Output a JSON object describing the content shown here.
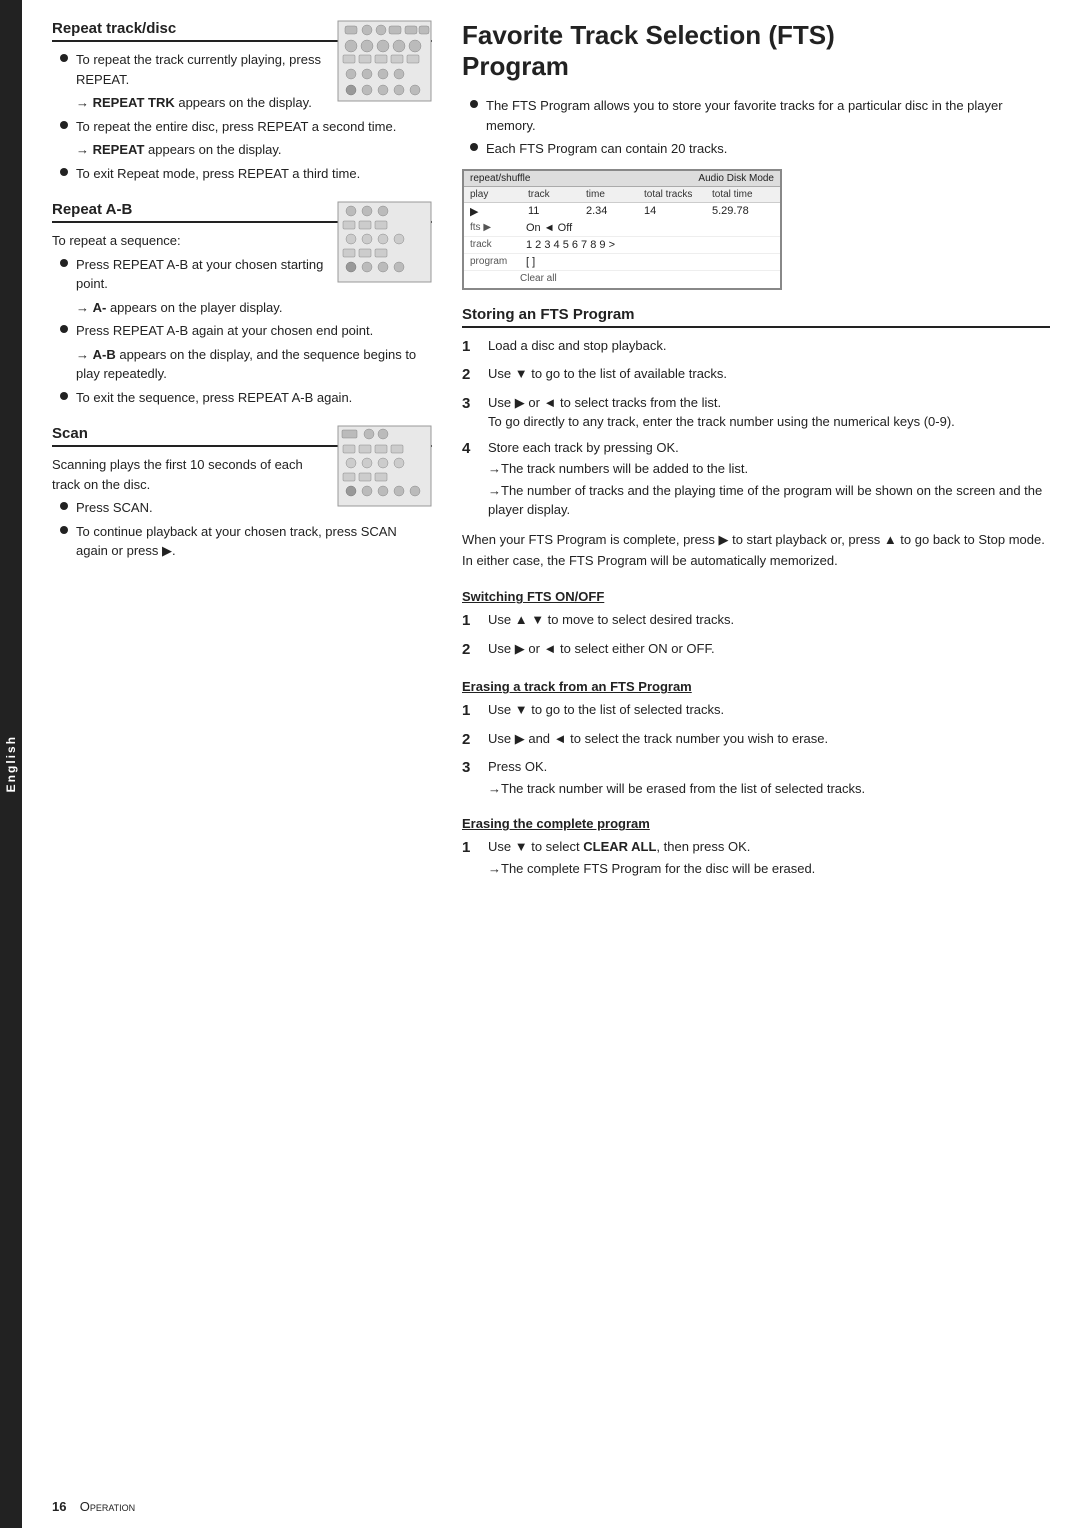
{
  "sidebar": {
    "label": "English"
  },
  "left": {
    "repeat_track_disc": {
      "title": "Repeat track/disc",
      "bullets": [
        "To repeat the track currently playing, press REPEAT.",
        "To repeat the entire disc, press REPEAT a second time.",
        "To exit Repeat mode, press REPEAT a third time."
      ],
      "arrows": [
        "→ REPEAT TRK appears on the display.",
        "→ REPEAT appears on the display."
      ]
    },
    "repeat_ab": {
      "title": "Repeat A-B",
      "intro": "To repeat a sequence:",
      "bullets": [
        "Press REPEAT A-B at your chosen starting point.",
        "Press REPEAT A-B again at your chosen end point.",
        "To exit the sequence, press REPEAT A-B again."
      ],
      "arrows": [
        "→ A- appears on the player display.",
        "→ A-B appears on the display, and the sequence begins to play repeatedly."
      ]
    },
    "scan": {
      "title": "Scan",
      "intro": "Scanning plays the first 10 seconds of each track on the disc.",
      "bullets": [
        "Press SCAN.",
        "To continue playback at your chosen track, press SCAN again or press ▶."
      ]
    }
  },
  "right": {
    "main_title_line1": "Favorite Track Selection (FTS)",
    "main_title_line2": "Program",
    "intro_bullets": [
      "The FTS Program allows you to store your favorite tracks for a particular disc in the player memory.",
      "Each FTS Program can contain 20 tracks."
    ],
    "fts_screen": {
      "header_left": "repeat/shuffle",
      "header_right": "Audio Disk Mode",
      "col_headers": [
        "play",
        "track",
        "time",
        "total tracks",
        "total time"
      ],
      "data_row": [
        "▶",
        "11",
        "2.34",
        "14",
        "5.29.78"
      ],
      "fts_label": "fts",
      "fts_value": "On ◄ Off",
      "track_label": "track",
      "track_value": "1  2  3  4  5  6  7  8  9  >",
      "program_label": "program",
      "program_value": "[ ]",
      "clear_all": "Clear all"
    },
    "storing_title": "Storing an FTS Program",
    "storing_steps": [
      {
        "num": "1",
        "text": "Load a disc and stop playback."
      },
      {
        "num": "2",
        "text": "Use ▼ to go to the list of available tracks."
      },
      {
        "num": "3",
        "text": "Use ▶ or ◄ to select tracks from the list.",
        "sub": "To go directly to any track, enter the track number using the numerical keys (0-9)."
      },
      {
        "num": "4",
        "text": "Store each track by pressing OK.",
        "arrows": [
          "→The track numbers will be added to the list.",
          "→The number of tracks and the playing time of the program will be shown on the screen and the player display."
        ]
      }
    ],
    "storing_para": "When your FTS Program is complete, press ▶ to start playback or, press ▲ to go back to Stop mode. In either case, the FTS Program will be automatically memorized.",
    "switching_title": "Switching FTS ON/OFF",
    "switching_steps": [
      {
        "num": "1",
        "text": "Use ▲ ▼ to move to select desired tracks."
      },
      {
        "num": "2",
        "text": "Use ▶ or ◄ to select either ON or OFF."
      }
    ],
    "erasing_track_title": "Erasing a track from an FTS Program",
    "erasing_track_steps": [
      {
        "num": "1",
        "text": "Use ▼ to go to the list of selected tracks."
      },
      {
        "num": "2",
        "text": "Use ▶ and ◄ to select the track number you wish to erase."
      },
      {
        "num": "3",
        "text": "Press OK.",
        "arrows": [
          "→The track number will be erased from the list of selected tracks."
        ]
      }
    ],
    "erasing_complete_title": "Erasing the complete program",
    "erasing_complete_steps": [
      {
        "num": "1",
        "text": "Use ▼ to select CLEAR ALL, then press OK.",
        "clear_all_bold": "CLEAR ALL",
        "arrows": [
          "→The complete FTS Program for the disc will be erased."
        ]
      }
    ]
  },
  "footer": {
    "page_num": "16",
    "label": "Operation"
  }
}
